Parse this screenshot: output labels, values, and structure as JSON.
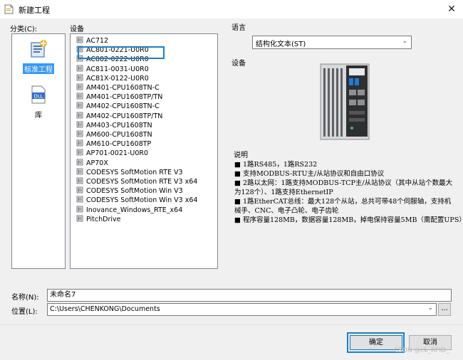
{
  "window": {
    "title": "新建工程",
    "close_icon": "close-icon"
  },
  "category": {
    "label": "分类(C):",
    "items": [
      {
        "label": "标准工程",
        "icon": "standard-project-icon",
        "selected": true
      },
      {
        "label": "库",
        "icon": "library-dll-icon",
        "icon_text": "DLL",
        "selected": false
      }
    ]
  },
  "devices": {
    "label": "设备",
    "items": [
      "AC712",
      "AC801-0221-U0R0",
      "AC802-0222-U0R0",
      "AC811-0031-U0R0",
      "AC81X-0122-U0R0",
      "AM401-CPU1608TN-C",
      "AM401-CPU1608TP/TN",
      "AM402-CPU1608TN-C",
      "AM402-CPU1608TP/TN",
      "AM403-CPU1608TN",
      "AM600-CPU1608TN",
      "AM610-CPU1608TP",
      "AP701-0021-U0R0",
      "AP70X",
      "CODESYS SoftMotion RTE V3",
      "CODESYS SoftMotion RTE V3 x64",
      "CODESYS SoftMotion Win V3",
      "CODESYS SoftMotion Win V3 x64",
      "Inovance_Windows_RTE_x64",
      "PitchDrive"
    ],
    "selected_index": 1
  },
  "language": {
    "label": "语言",
    "value": "结构化文本(ST)"
  },
  "device_preview": {
    "label": "设备"
  },
  "description": {
    "label": "说明",
    "lines": [
      "■ 1路RS485，1路RS232",
      "■ 支持MODBUS-RTU主/从站协议和自由口协议",
      "■ 2路以太网：1路支持MODBUS-TCP主/从站协议（其中从站个数最大",
      "为128个）、1路支持EthernetIP",
      "■ 1路EtherCAT总线：最大128个从站，总共可带48个伺服轴，支持机",
      "械手、CNC、电子凸轮、电子齿轮",
      "■ 程序容量128MB，数据容量128MB，掉电保持容量5MB（需配置UPS）"
    ]
  },
  "name_field": {
    "label": "名称(N):",
    "value": "未命名7"
  },
  "location_field": {
    "label": "位置(L):",
    "value": "C:\\Users\\CHENKONG\\Documents",
    "browse_label": "..."
  },
  "buttons": {
    "ok": "确定",
    "cancel": "取消"
  },
  "watermark": "CSDN @ck_RFID_",
  "colors": {
    "selection": "#3399ff",
    "highlight_box": "#1a7fd0",
    "dialog_bg": "#f0f0f0"
  }
}
